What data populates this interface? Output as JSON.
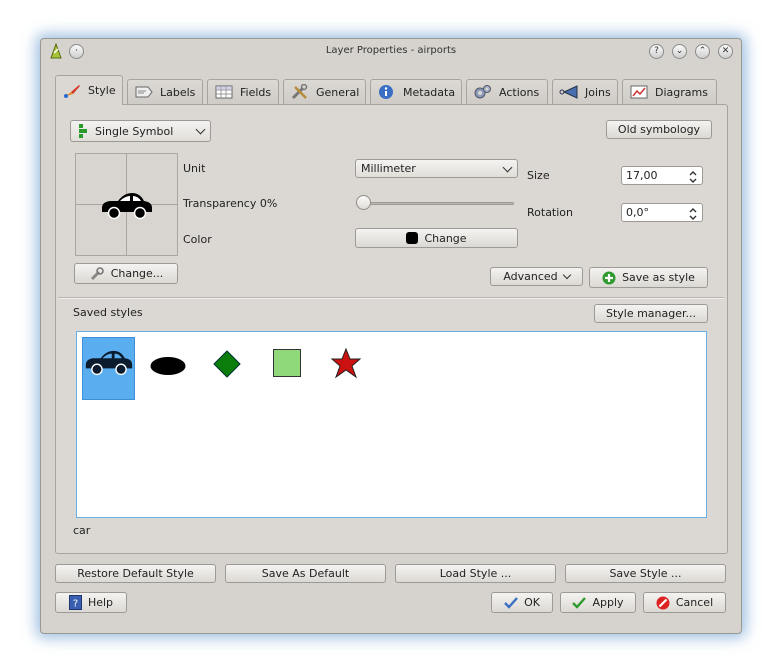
{
  "window": {
    "title": "Layer Properties - airports",
    "buttons": [
      "?",
      "⌄",
      "⌃",
      "✕"
    ]
  },
  "tabs": [
    {
      "label": "Style",
      "icon": "paintbrush-icon",
      "active": true
    },
    {
      "label": "Labels",
      "icon": "label-icon"
    },
    {
      "label": "Fields",
      "icon": "table-icon"
    },
    {
      "label": "General",
      "icon": "tools-icon"
    },
    {
      "label": "Metadata",
      "icon": "info-icon"
    },
    {
      "label": "Actions",
      "icon": "gears-icon"
    },
    {
      "label": "Joins",
      "icon": "join-icon"
    },
    {
      "label": "Diagrams",
      "icon": "diagram-icon"
    }
  ],
  "style": {
    "renderer": "Single Symbol",
    "old_symbology": "Old symbology",
    "unit_label": "Unit",
    "unit_value": "Millimeter",
    "transparency_label": "Transparency 0%",
    "transparency_value": 0,
    "color_label": "Color",
    "color_button": "Change",
    "color_swatch": "#000000",
    "size_label": "Size",
    "size_value": "17,00",
    "rotation_label": "Rotation",
    "rotation_value": "0,0°",
    "change_button": "Change...",
    "advanced_button": "Advanced",
    "save_as_style": "Save as style",
    "saved_styles_label": "Saved styles",
    "style_manager": "Style manager...",
    "selected_style_name": "car",
    "symbols": [
      {
        "name": "car",
        "shape": "car",
        "color": "#0c1b2e",
        "selected": true
      },
      {
        "name": "ellipse",
        "shape": "ellipse",
        "color": "#000000"
      },
      {
        "name": "diamond",
        "shape": "diamond",
        "color": "#0a7d0a"
      },
      {
        "name": "square",
        "shape": "square",
        "color": "#8fd97a"
      },
      {
        "name": "star",
        "shape": "star",
        "color": "#cc1111"
      }
    ]
  },
  "footer": {
    "restore_default": "Restore Default Style",
    "save_as_default": "Save As Default",
    "load_style": "Load Style ...",
    "save_style": "Save Style ...",
    "help": "Help",
    "ok": "OK",
    "apply": "Apply",
    "cancel": "Cancel"
  },
  "colors": {
    "selection": "#5aaef0",
    "list_border": "#6ab0e8"
  }
}
